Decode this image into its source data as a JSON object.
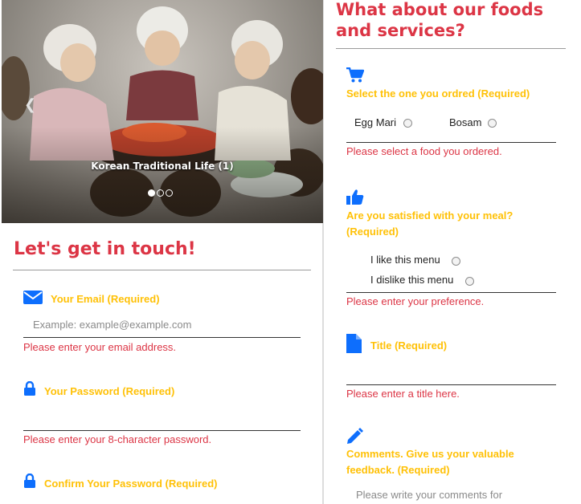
{
  "carousel": {
    "caption": "Korean Traditional Life (1)",
    "prev_icon": "chevron-left-icon"
  },
  "contact": {
    "title": "Let's get in touch!",
    "email": {
      "icon": "envelope-icon",
      "label": "Your Email (Required)",
      "placeholder": "Example: example@example.com",
      "error": "Please enter your email address."
    },
    "password": {
      "icon": "lock-icon",
      "label": "Your Password (Required)",
      "error": "Please enter your 8-character password."
    },
    "confirm": {
      "icon": "lock-icon",
      "label": "Confirm Your Password (Required)"
    }
  },
  "feedback": {
    "title": "What about our foods and services?",
    "food": {
      "icon": "cart-icon",
      "label": "Select the one you ordred (Required)",
      "options": [
        "Egg Mari",
        "Bosam"
      ],
      "error": "Please select a food you ordered."
    },
    "satisfied": {
      "icon": "thumbs-up-icon",
      "label_line1": "Are you satisfied with your meal?",
      "label_line2": "(Required)",
      "options": [
        "I like this menu",
        "I dislike this menu"
      ],
      "error": "Please enter your preference."
    },
    "titlefield": {
      "icon": "file-icon",
      "label": "Title (Required)",
      "error": "Please enter a title here."
    },
    "comments": {
      "icon": "pencil-icon",
      "label_line1": "Comments. Give us your valuable",
      "label_line2": "feedback. (Required)",
      "placeholder": "Please write your comments for"
    }
  },
  "colors": {
    "accent_red": "#dc3545",
    "label_yellow": "#ffc107",
    "icon_blue": "#0d6efd"
  }
}
